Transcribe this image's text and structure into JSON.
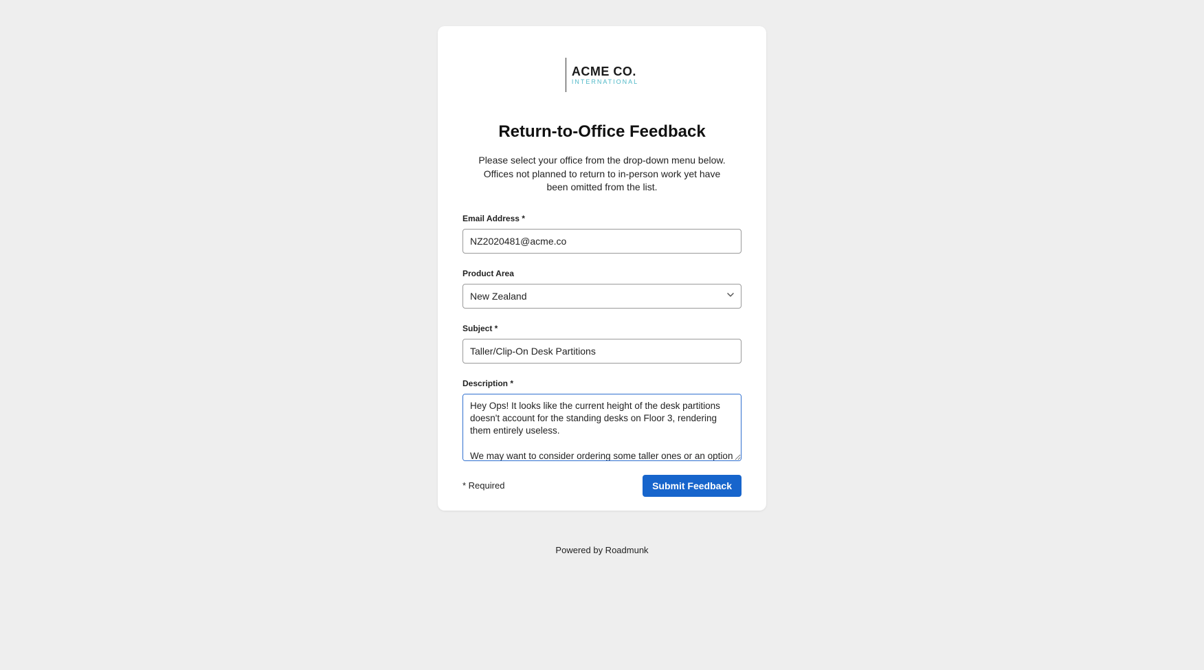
{
  "logo": {
    "main": "ACME CO.",
    "sub": "INTERNATIONAL"
  },
  "title": "Return-to-Office Feedback",
  "intro": "Please select your office from the drop-down menu below. Offices not planned to return to in-person work yet have been omitted from the list.",
  "fields": {
    "email": {
      "label": "Email Address *",
      "value": "NZ2020481@acme.co"
    },
    "product_area": {
      "label": "Product Area",
      "value": "New Zealand"
    },
    "subject": {
      "label": "Subject *",
      "value": "Taller/Clip-On Desk Partitions"
    },
    "description": {
      "label": "Description *",
      "value": "Hey Ops! It looks like the current height of the desk partitions doesn't account for the standing desks on Floor 3, rendering them entirely useless.\n\nWe may want to consider ordering some taller ones or an option that clips onto the side of the desk (so it moves with the desk)."
    }
  },
  "required_note": "* Required",
  "submit_label": "Submit Feedback",
  "powered_by": "Powered by Roadmunk"
}
